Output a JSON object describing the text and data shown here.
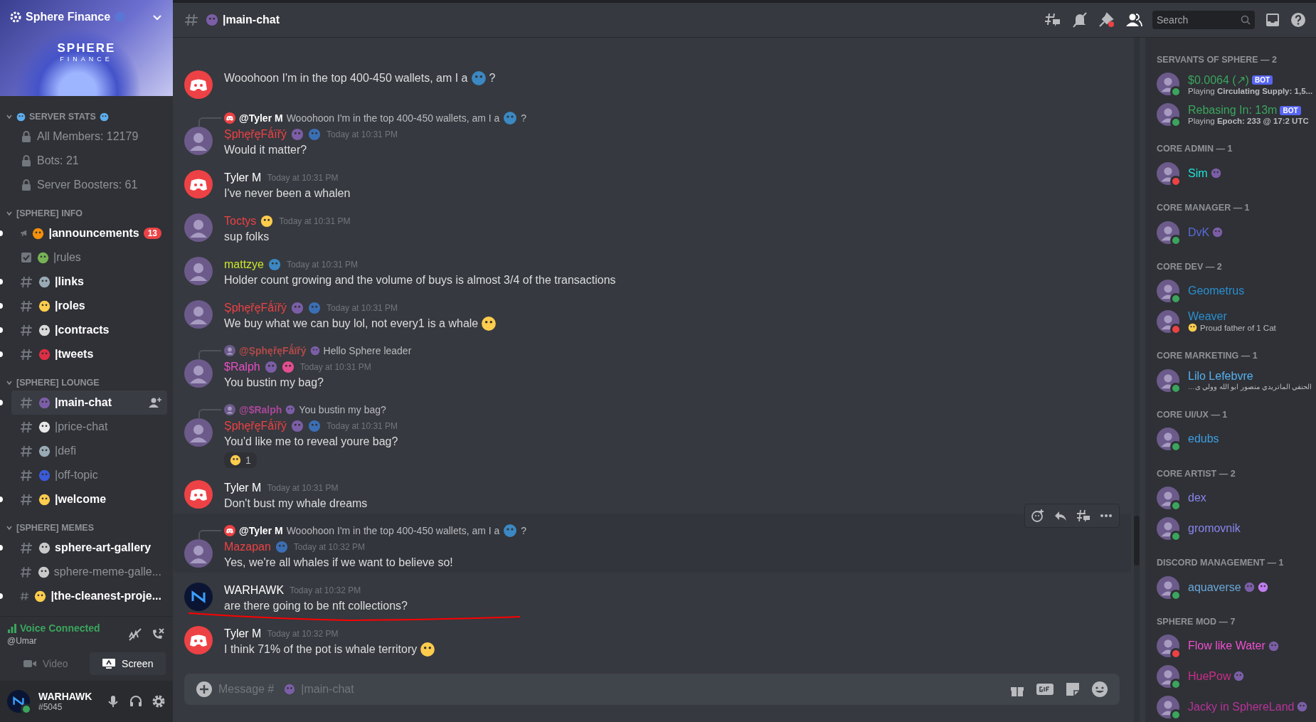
{
  "server": {
    "name": "Sphere Finance",
    "banner_title": "SPHERE",
    "banner_subtitle": "FINANCE"
  },
  "categories": [
    {
      "name": "SERVER STATS",
      "emoji": {
        "kind": "stats"
      },
      "expanded": true,
      "channels": [
        {
          "kind": "locked",
          "name": "All Members: 12179",
          "unread": false,
          "selected": false
        },
        {
          "kind": "locked",
          "name": "Bots: 21",
          "unread": false,
          "selected": false
        },
        {
          "kind": "locked",
          "name": "Server Boosters: 61",
          "unread": false,
          "selected": false
        }
      ]
    },
    {
      "name": "[SPHERE] INFO",
      "expanded": true,
      "channels": [
        {
          "kind": "announcement",
          "emoji": {
            "kind": "bell"
          },
          "name": "|announcements",
          "unread": true,
          "selected": false,
          "badge": "13"
        },
        {
          "kind": "rules",
          "emoji": {
            "kind": "books"
          },
          "name": "|rules",
          "unread": false,
          "selected": false
        },
        {
          "kind": "text",
          "emoji": {
            "kind": "link"
          },
          "name": "|links",
          "unread": true,
          "selected": false
        },
        {
          "kind": "text",
          "emoji": {
            "kind": "warning"
          },
          "name": "|roles",
          "unread": true,
          "selected": false
        },
        {
          "kind": "text",
          "emoji": {
            "kind": "memo"
          },
          "name": "|contracts",
          "unread": true,
          "selected": false
        },
        {
          "kind": "text",
          "emoji": {
            "kind": "bird"
          },
          "name": "|tweets",
          "unread": true,
          "selected": false
        }
      ]
    },
    {
      "name": "[SPHERE] LOUNGE",
      "expanded": true,
      "channels": [
        {
          "kind": "text",
          "emoji": {
            "kind": "crystal"
          },
          "name": "|main-chat",
          "unread": true,
          "selected": true
        },
        {
          "kind": "text",
          "emoji": {
            "kind": "chart"
          },
          "name": "|price-chat",
          "unread": false,
          "selected": false
        },
        {
          "kind": "text",
          "emoji": {
            "kind": "dollar"
          },
          "name": "|defi",
          "unread": false,
          "selected": false
        },
        {
          "kind": "text",
          "emoji": {
            "kind": "cyclone"
          },
          "name": "|off-topic",
          "unread": false,
          "selected": false
        },
        {
          "kind": "text",
          "emoji": {
            "kind": "wave"
          },
          "name": "|welcome",
          "unread": true,
          "selected": false
        }
      ]
    },
    {
      "name": "[SPHERE] MEMES",
      "expanded": true,
      "channels": [
        {
          "kind": "text",
          "emoji": {
            "kind": "frame"
          },
          "name": "sphere-art-gallery",
          "unread": true,
          "selected": false
        },
        {
          "kind": "text",
          "emoji": {
            "kind": "frame"
          },
          "name": "sphere-meme-galle...",
          "unread": false,
          "selected": false
        },
        {
          "kind": "text",
          "emoji": {
            "kind": "clap"
          },
          "name": "|the-cleanest-proje...",
          "unread": true,
          "selected": false
        }
      ]
    }
  ],
  "voice": {
    "status": "Voice Connected",
    "channel": "@Umar",
    "buttons": [
      "Video",
      "Screen"
    ]
  },
  "user": {
    "name": "WARHAWK",
    "tag": "#5045",
    "dnd": false
  },
  "header": {
    "emoji": {
      "kind": "crystal"
    },
    "channel": "|main-chat",
    "search_placeholder": "Search"
  },
  "messages": [
    {
      "avatar": {
        "kind": "default"
      },
      "text": "Wooohoon I'm in the top 400-450 wallets, am I a",
      "emoji": {
        "kind": "whale"
      },
      "after": "?",
      "highlighted": false
    },
    {
      "reply": {
        "avatar": {
          "kind": "default"
        },
        "author": "@Tyler M",
        "color": "#ffffff",
        "text": "Wooohoon I'm in the top 400-450 wallets, am I a",
        "emoji": {
          "kind": "whale"
        },
        "after": "?"
      },
      "avatar": {
        "kind": "image"
      },
      "author": "ȘphęřęFǻïřý",
      "color": "#ed4245",
      "badges": [
        {
          "kind": "crystal"
        },
        {
          "kind": "parrot"
        }
      ],
      "time": "Today at 10:31 PM",
      "text": "Would it matter?",
      "highlighted": false
    },
    {
      "avatar": {
        "kind": "default"
      },
      "author": "Tyler M",
      "color": "#ffffff",
      "time": "Today at 10:31 PM",
      "text": "I've never been a whalen",
      "highlighted": false
    },
    {
      "avatar": {
        "kind": "image"
      },
      "author": "Toctys",
      "color": "#ed4245",
      "badges": [
        {
          "kind": "warning"
        }
      ],
      "time": "Today at 10:31 PM",
      "text": "sup folks",
      "highlighted": false
    },
    {
      "avatar": {
        "kind": "image"
      },
      "author": "mattzye",
      "color": "#c9e52d",
      "badges": [
        {
          "kind": "check"
        }
      ],
      "time": "Today at 10:31 PM",
      "text": "Holder count growing and the volume of buys is almost 3/4 of the transactions",
      "highlighted": false
    },
    {
      "avatar": {
        "kind": "image"
      },
      "author": "ȘphęřęFǻïřý",
      "color": "#ed4245",
      "badges": [
        {
          "kind": "crystal"
        },
        {
          "kind": "parrot"
        }
      ],
      "time": "Today at 10:31 PM",
      "text": "We buy what we can buy lol, not every1 is a whale",
      "emoji": {
        "kind": "rofl"
      },
      "highlighted": false
    },
    {
      "reply": {
        "avatar": {
          "kind": "image"
        },
        "author": "@ȘphęřęFǻïřý",
        "color": "#b34a4a",
        "badges": [
          {
            "kind": "crystal"
          }
        ],
        "text": "Hello Sphere leader"
      },
      "avatar": {
        "kind": "image"
      },
      "author": "$Ralph",
      "color": "#e84fc4",
      "badges": [
        {
          "kind": "crystal"
        },
        {
          "kind": "spiral"
        }
      ],
      "time": "Today at 10:31 PM",
      "text": "You bustin my bag?",
      "highlighted": false
    },
    {
      "reply": {
        "avatar": {
          "kind": "image"
        },
        "author": "@$Ralph",
        "color": "#a8489a",
        "badges": [
          {
            "kind": "crystal"
          }
        ],
        "text": "You bustin my bag?"
      },
      "avatar": {
        "kind": "image"
      },
      "author": "ȘphęřęFǻïřý",
      "color": "#ed4245",
      "badges": [
        {
          "kind": "crystal"
        },
        {
          "kind": "parrot"
        }
      ],
      "time": "Today at 10:31 PM",
      "text": "You'd like me to reveal youre bag?",
      "reactions": [
        {
          "emoji": {
            "kind": "person"
          },
          "count": "1"
        }
      ],
      "highlighted": false
    },
    {
      "avatar": {
        "kind": "default"
      },
      "author": "Tyler M",
      "color": "#ffffff",
      "time": "Today at 10:31 PM",
      "text": "Don't bust my whale dreams",
      "highlighted": false
    },
    {
      "reply": {
        "avatar": {
          "kind": "default"
        },
        "author": "@Tyler M",
        "color": "#ffffff",
        "text": "Wooohoon I'm in the top 400-450 wallets, am I a",
        "emoji": {
          "kind": "whale"
        },
        "after": "?"
      },
      "avatar": {
        "kind": "image"
      },
      "author": "Mazapan",
      "color": "#ed4245",
      "badges": [
        {
          "kind": "parrot"
        }
      ],
      "time": "Today at 10:32 PM",
      "text": "Yes, we're all whales if we want to believe so!",
      "highlighted": true
    },
    {
      "avatar": {
        "kind": "logo"
      },
      "author": "WARHAWK",
      "color": "#ffffff",
      "time": "Today at 10:32 PM",
      "text": "are there going to be nft collections?",
      "highlighted": false
    },
    {
      "avatar": {
        "kind": "default"
      },
      "author": "Tyler M",
      "color": "#ffffff",
      "time": "Today at 10:32 PM",
      "text": "I think 71% of the pot is whale territory",
      "emoji": {
        "kind": "laugh"
      },
      "highlighted": false
    }
  ],
  "composer": {
    "placeholder": "Message #",
    "emoji": {
      "kind": "crystal"
    },
    "placeholder_channel": "|main-chat"
  },
  "member_groups": [
    {
      "title": "SERVANTS OF SPHERE — 2",
      "members": [
        {
          "name": "$0.0064 (↗)",
          "color": "#3ba55d",
          "dnd": false,
          "bot": "BOT",
          "activity": "Playing **Circulating Supply: 1,5...**"
        },
        {
          "name": "Rebasing In: 13m",
          "color": "#3ba55d",
          "dnd": false,
          "bot": "BOT",
          "activity": "Playing **Epoch: 233 @ 17:2 UTC**"
        }
      ]
    },
    {
      "title": "CORE ADMIN — 1",
      "members": [
        {
          "name": "Sim",
          "color": "#1ee3d7",
          "dnd": true,
          "badges": [
            {
              "kind": "crystal"
            }
          ]
        }
      ]
    },
    {
      "title": "CORE MANAGER — 1",
      "members": [
        {
          "name": "DvK",
          "color": "#5a6bd8",
          "dnd": false,
          "badges": [
            {
              "kind": "crystal"
            }
          ]
        }
      ]
    },
    {
      "title": "CORE DEV — 2",
      "members": [
        {
          "name": "Geometrus",
          "color": "#2a8fd0",
          "dnd": false
        },
        {
          "name": "Weaver",
          "color": "#2a8fd0",
          "dnd": true,
          "activity_emoji": {
            "kind": "cat"
          },
          "activity": "Proud father of 1 Cat"
        }
      ]
    },
    {
      "title": "CORE MARKETING — 1",
      "members": [
        {
          "name": "Lilo Lefebvre",
          "color": "#57b0f0",
          "dnd": false,
          "activity": "الحنفي الماتريدي منصور ابو الله وولي ى…",
          "rtl": true
        }
      ]
    },
    {
      "title": "CORE UI/UX — 1",
      "members": [
        {
          "name": "edubs",
          "color": "#3d9ee0",
          "dnd": false
        }
      ]
    },
    {
      "title": "CORE ARTIST — 2",
      "members": [
        {
          "name": "dex",
          "color": "#8a85ef",
          "dnd": false
        },
        {
          "name": "gromovnik",
          "color": "#8a85ef",
          "dnd": false
        }
      ]
    },
    {
      "title": "DISCORD MANAGEMENT — 1",
      "members": [
        {
          "name": "aquaverse",
          "color": "#6aa7d8",
          "dnd": false,
          "badges": [
            {
              "kind": "crystal"
            },
            {
              "kind": "gem"
            }
          ]
        }
      ]
    },
    {
      "title": "SPHERE MOD — 7",
      "members": [
        {
          "name": "Flow like Water",
          "color": "#ef4fd0",
          "dnd": true,
          "badges": [
            {
              "kind": "crystal"
            }
          ]
        },
        {
          "name": "HuePow",
          "color": "#cc2d8b",
          "dnd": false,
          "badges": [
            {
              "kind": "crystal"
            }
          ]
        },
        {
          "name": "Jacky in SphereLand",
          "color": "#b8339a",
          "dnd": false,
          "badges": [
            {
              "kind": "crystal"
            }
          ]
        }
      ]
    }
  ]
}
